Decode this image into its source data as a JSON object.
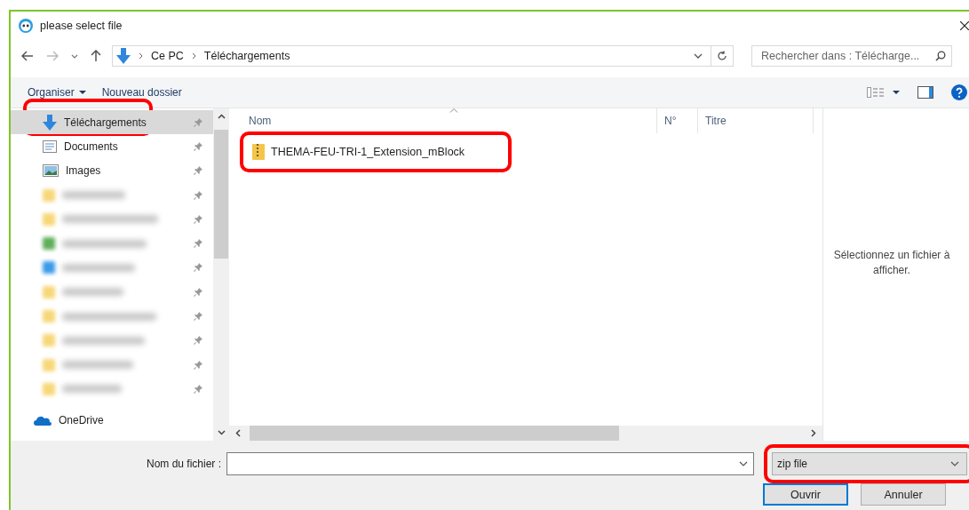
{
  "window": {
    "title": "please select file"
  },
  "address": {
    "crumbs": [
      "Ce PC",
      "Téléchargements"
    ],
    "search_placeholder": "Rechercher dans : Télécharge..."
  },
  "toolbar": {
    "organize": "Organiser",
    "new_folder": "Nouveau dossier"
  },
  "nav": [
    {
      "kind": "download",
      "label": "Téléchargements",
      "selected": true,
      "highlighted": true,
      "pinned": true
    },
    {
      "kind": "documents",
      "label": "Documents",
      "selected": false,
      "highlighted": false,
      "pinned": true
    },
    {
      "kind": "images",
      "label": "Images",
      "selected": false,
      "highlighted": false,
      "pinned": true
    },
    {
      "kind": "blurred",
      "color": "#f7d778",
      "selected": false,
      "highlighted": false,
      "pinned": true
    },
    {
      "kind": "blurred",
      "color": "#f7d778",
      "selected": false,
      "highlighted": false,
      "pinned": true
    },
    {
      "kind": "blurred",
      "color": "#5fae5a",
      "selected": false,
      "highlighted": false,
      "pinned": true
    },
    {
      "kind": "blurred",
      "color": "#3d9be9",
      "selected": false,
      "highlighted": false,
      "pinned": true
    },
    {
      "kind": "blurred",
      "color": "#f7d778",
      "selected": false,
      "highlighted": false,
      "pinned": true
    },
    {
      "kind": "blurred",
      "color": "#f7d778",
      "selected": false,
      "highlighted": false,
      "pinned": true
    },
    {
      "kind": "blurred",
      "color": "#f7d778",
      "selected": false,
      "highlighted": false,
      "pinned": true
    },
    {
      "kind": "blurred",
      "color": "#f7d778",
      "selected": false,
      "highlighted": false,
      "pinned": true
    },
    {
      "kind": "blurred",
      "color": "#f7d778",
      "selected": false,
      "highlighted": false,
      "pinned": true
    },
    {
      "kind": "onedrive",
      "label": "OneDrive",
      "selected": false,
      "highlighted": false,
      "pinned": false
    }
  ],
  "columns": [
    "Nom",
    "N°",
    "Titre"
  ],
  "files": [
    {
      "name": "THEMA-FEU-TRI-1_Extension_mBlock",
      "highlighted": true
    }
  ],
  "preview": {
    "message": "Sélectionnez un fichier à afficher."
  },
  "footer": {
    "filename_label": "Nom du fichier :",
    "file_type": "zip file",
    "file_type_highlighted": true,
    "open": "Ouvrir",
    "cancel": "Annuler"
  }
}
